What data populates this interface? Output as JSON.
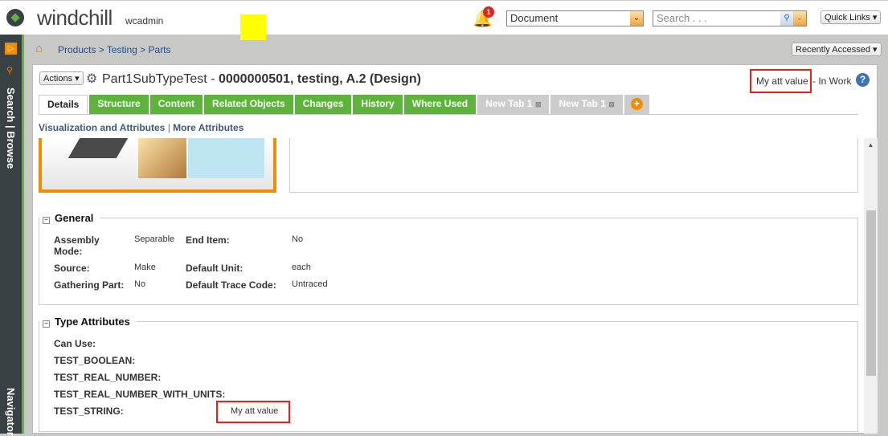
{
  "header": {
    "logo": "windchill",
    "user": "wcadmin",
    "notification_count": "1",
    "search_type": "Document",
    "search_placeholder": "Search . . .",
    "quick_links": "Quick Links"
  },
  "sidebar": {
    "search_browse": "Search | Browse",
    "navigator": "Navigator"
  },
  "breadcrumb": {
    "path": "Products > Testing > Parts",
    "recently_accessed": "Recently Accessed"
  },
  "object": {
    "actions": "Actions",
    "name": "Part1SubTypeTest - ",
    "ident": "0000000501, testing, A.2 (Design)",
    "att_value": "My att value",
    "state": "- In Work"
  },
  "tabs": [
    {
      "label": "Details"
    },
    {
      "label": "Structure"
    },
    {
      "label": "Content"
    },
    {
      "label": "Related Objects"
    },
    {
      "label": "Changes"
    },
    {
      "label": "History"
    },
    {
      "label": "Where Used"
    },
    {
      "label": "New Tab 1"
    },
    {
      "label": "New Tab 1"
    }
  ],
  "subnav": {
    "viz": "Visualization and Attributes",
    "more": "More Attributes"
  },
  "general": {
    "title": "General",
    "rows": [
      {
        "l1": "Assembly Mode:",
        "v1": "Separable",
        "l2": "End Item:",
        "v2": "No"
      },
      {
        "l1": "Source:",
        "v1": "Make",
        "l2": "Default Unit:",
        "v2": "each"
      },
      {
        "l1": "Gathering Part:",
        "v1": "No",
        "l2": "Default Trace Code:",
        "v2": "Untraced"
      }
    ]
  },
  "type_attributes": {
    "title": "Type Attributes",
    "rows": [
      {
        "label": "Can Use:",
        "value": ""
      },
      {
        "label": "TEST_BOOLEAN:",
        "value": ""
      },
      {
        "label": "TEST_REAL_NUMBER:",
        "value": ""
      },
      {
        "label": "TEST_REAL_NUMBER_WITH_UNITS:",
        "value": ""
      },
      {
        "label": "TEST_STRING:",
        "value": "My att value"
      }
    ]
  }
}
